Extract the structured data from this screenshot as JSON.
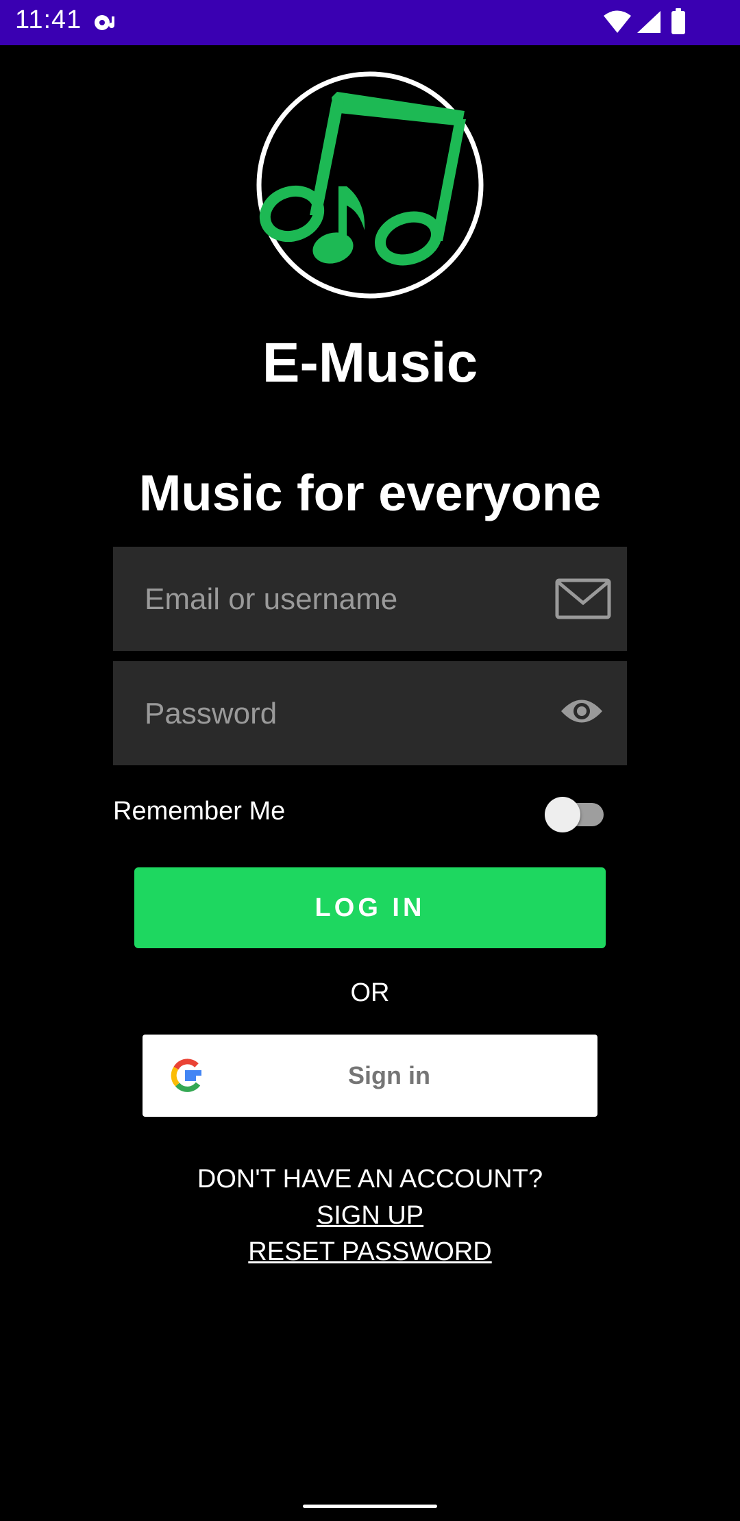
{
  "status_bar": {
    "time": "11:41",
    "icons": [
      "media-icon",
      "wifi-icon",
      "signal-icon",
      "battery-icon"
    ],
    "background_color": "#3a00b2"
  },
  "app": {
    "logo_icon": "music-notes-icon",
    "title": "E-Music",
    "tagline": "Music for everyone"
  },
  "login_form": {
    "email_placeholder": "Email or username",
    "email_icon": "mail-icon",
    "password_placeholder": "Password",
    "password_icon": "eye-icon",
    "remember_label": "Remember Me",
    "remember_on": false,
    "login_label": "LOG IN",
    "accent_color": "#1ed760"
  },
  "alt_login": {
    "or_label": "OR",
    "google_icon": "google-icon",
    "google_label": "Sign in"
  },
  "footer": {
    "no_account": "DON'T HAVE AN ACCOUNT?",
    "sign_up": "SIGN UP",
    "reset_password": "RESET PASSWORD"
  }
}
